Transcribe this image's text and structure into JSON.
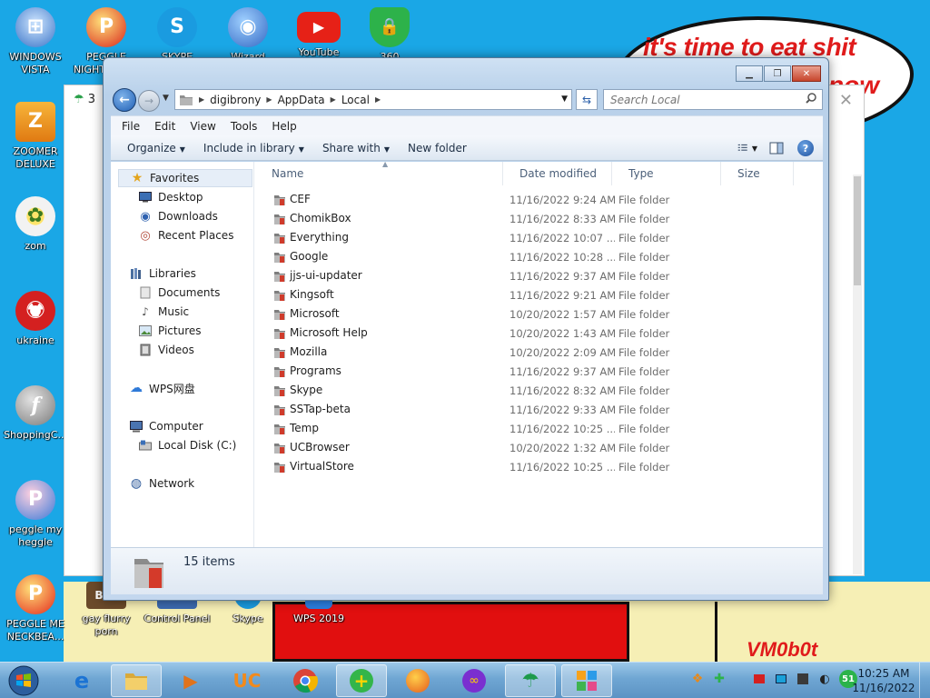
{
  "wallpaper": {
    "bubble_text": "it's time to eat shit",
    "bubble_text2": "now",
    "signature": "VM0b0t"
  },
  "desktop_icons": [
    {
      "label": "WINDOWS VISTA",
      "icon": "windows-vista-icon",
      "color": "#3a74c7"
    },
    {
      "label": "PEGGLE NIGHTS MOD",
      "icon": "peggle-icon",
      "color": "#d9261c"
    },
    {
      "label": "SKYPE",
      "icon": "skype-icon",
      "color": "#1a9be0"
    },
    {
      "label": "Wizard",
      "icon": "globe-icon",
      "color": "#3469c4"
    },
    {
      "label": "YouTube",
      "icon": "youtube-icon",
      "color": "#e62117"
    },
    {
      "label": "360",
      "icon": "shield-icon",
      "color": "#2db24a"
    },
    {
      "label": "ZOOMER DELUXE",
      "icon": "zoomer-icon",
      "color": "#e07a12"
    },
    {
      "label": "zom",
      "icon": "flower-icon",
      "color": "#f2f2f2"
    },
    {
      "label": "ukraine",
      "icon": "radiation-icon",
      "color": "#d42020"
    },
    {
      "label": "ShoppingC...",
      "icon": "flash-icon",
      "color": "#8c8c8c"
    },
    {
      "label": "peggle my heggle",
      "icon": "peggle-icon",
      "color": "#3a7ad8"
    },
    {
      "label": "PEGGLE ME NECKBEA...",
      "icon": "peggle-icon",
      "color": "#e4281c"
    },
    {
      "label": "gay flurry porn",
      "icon": "box-icon",
      "color": "#6b4a2a"
    },
    {
      "label": "Control Panel",
      "icon": "control-panel-icon",
      "color": "#3c6ab0"
    },
    {
      "label": "Skype",
      "icon": "skype-icon",
      "color": "#1a9be0"
    },
    {
      "label": "WPS 2019",
      "icon": "wps-icon",
      "color": "#2b7fe0"
    }
  ],
  "bg_window": {
    "tab_label": "3",
    "close_label": "✕"
  },
  "explorer": {
    "window_controls": {
      "minimize": "▁",
      "maximize": "❐",
      "close": "✕"
    },
    "address": {
      "crumbs": [
        "digibrony",
        "AppData",
        "Local"
      ]
    },
    "search": {
      "placeholder": "Search Local"
    },
    "menu": [
      "File",
      "Edit",
      "View",
      "Tools",
      "Help"
    ],
    "commands": {
      "organize": "Organize",
      "include": "Include in library",
      "share": "Share with",
      "new_folder": "New folder"
    },
    "nav": {
      "favorites": "Favorites",
      "desktop": "Desktop",
      "downloads": "Downloads",
      "recent": "Recent Places",
      "libraries": "Libraries",
      "documents": "Documents",
      "music": "Music",
      "pictures": "Pictures",
      "videos": "Videos",
      "wps": "WPS网盘",
      "computer": "Computer",
      "local_disk": "Local Disk (C:)",
      "network": "Network"
    },
    "columns": {
      "name": "Name",
      "date": "Date modified",
      "type": "Type",
      "size": "Size"
    },
    "files": [
      {
        "name": "CEF",
        "date": "11/16/2022 9:24 AM",
        "type": "File folder"
      },
      {
        "name": "ChomikBox",
        "date": "11/16/2022 8:33 AM",
        "type": "File folder"
      },
      {
        "name": "Everything",
        "date": "11/16/2022 10:07 ...",
        "type": "File folder"
      },
      {
        "name": "Google",
        "date": "11/16/2022 10:28 ...",
        "type": "File folder"
      },
      {
        "name": "jjs-ui-updater",
        "date": "11/16/2022 9:37 AM",
        "type": "File folder"
      },
      {
        "name": "Kingsoft",
        "date": "11/16/2022 9:21 AM",
        "type": "File folder"
      },
      {
        "name": "Microsoft",
        "date": "10/20/2022 1:57 AM",
        "type": "File folder"
      },
      {
        "name": "Microsoft Help",
        "date": "10/20/2022 1:43 AM",
        "type": "File folder"
      },
      {
        "name": "Mozilla",
        "date": "10/20/2022 2:09 AM",
        "type": "File folder"
      },
      {
        "name": "Programs",
        "date": "11/16/2022 9:37 AM",
        "type": "File folder"
      },
      {
        "name": "Skype",
        "date": "11/16/2022 8:32 AM",
        "type": "File folder"
      },
      {
        "name": "SSTap-beta",
        "date": "11/16/2022 9:33 AM",
        "type": "File folder"
      },
      {
        "name": "Temp",
        "date": "11/16/2022 10:25 ...",
        "type": "File folder"
      },
      {
        "name": "UCBrowser",
        "date": "10/20/2022 1:32 AM",
        "type": "File folder"
      },
      {
        "name": "VirtualStore",
        "date": "11/16/2022 10:25 ...",
        "type": "File folder"
      }
    ],
    "status": {
      "item_count": "15 items"
    }
  },
  "taskbar": {
    "tray_badge": "51",
    "clock_time": "10:25 AM",
    "clock_date": "11/16/2022"
  }
}
